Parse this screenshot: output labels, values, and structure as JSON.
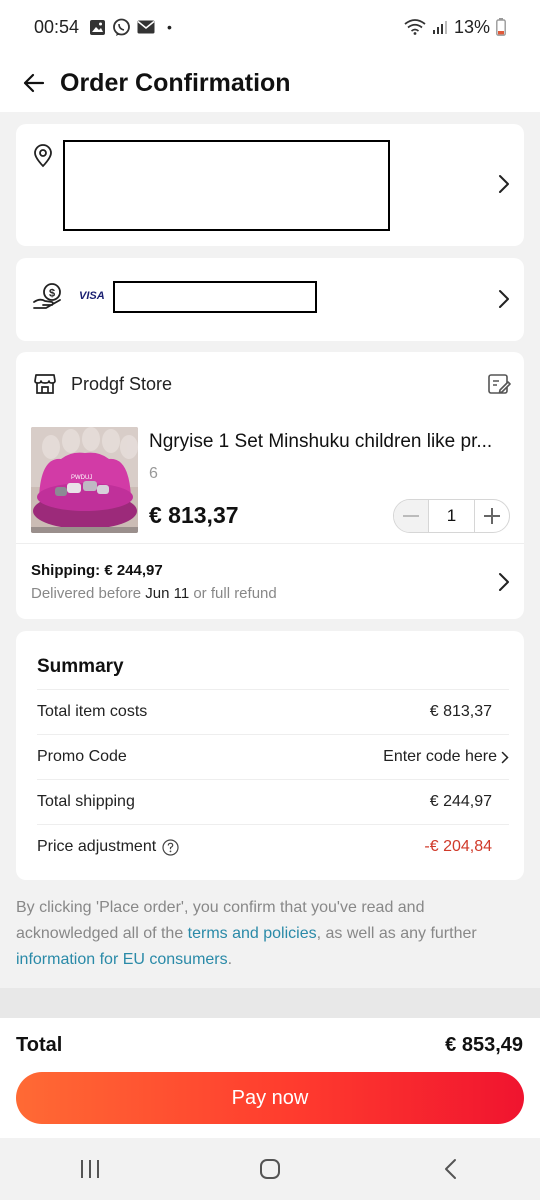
{
  "status": {
    "time": "00:54",
    "battery": "13%",
    "dot": "•"
  },
  "header": {
    "title": "Order Confirmation"
  },
  "payment": {
    "card_brand": "VISA"
  },
  "store": {
    "name": "Prodgf Store"
  },
  "product": {
    "title": "Ngryise 1 Set Minshuku children like pr...",
    "variant": "6",
    "price": "€ 813,37",
    "quantity": "1",
    "image_text": "PWDUJ"
  },
  "shipping": {
    "label": "Shipping: € 244,97",
    "delivered_prefix": "Delivered before",
    "delivered_date": "Jun 11",
    "delivered_suffix": "or full refund"
  },
  "summary": {
    "title": "Summary",
    "rows": [
      {
        "label": "Total item costs",
        "value": "€ 813,37"
      },
      {
        "label": "Promo Code",
        "value": "Enter code here"
      },
      {
        "label": "Total shipping",
        "value": "€ 244,97"
      },
      {
        "label": "Price adjustment",
        "value": "-€ 204,84"
      }
    ]
  },
  "legal": {
    "part1": "By clicking 'Place order', you confirm that you've read and acknowledged all of the ",
    "link1": "terms and policies",
    "part2": ", as well as any further ",
    "link2": "information for EU consumers",
    "part3": "."
  },
  "footer": {
    "total_label": "Total",
    "total_value": "€ 853,49",
    "pay_label": "Pay now"
  },
  "colors": {
    "accent": "#ff3b2e",
    "link": "#2a8aa8",
    "negative": "#d03a2a"
  }
}
